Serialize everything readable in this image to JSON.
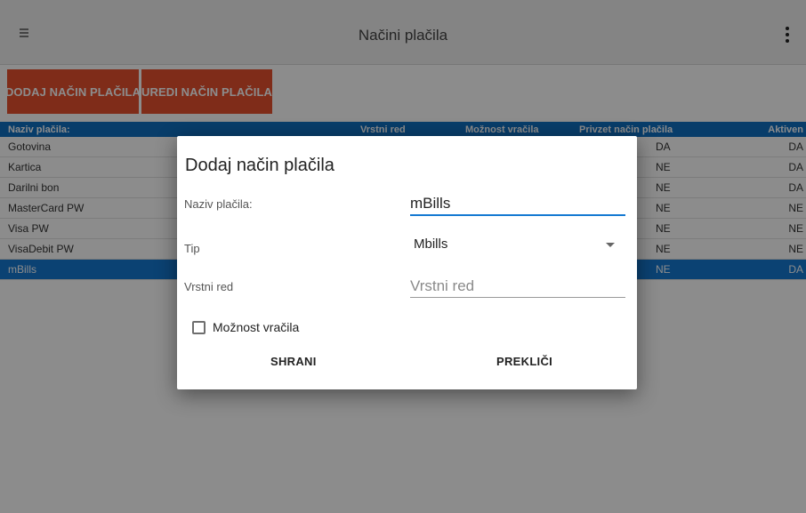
{
  "appbar": {
    "title": "Načini plačila",
    "menu_icon": "hamburger-icon",
    "overflow_icon": "more-vert-icon"
  },
  "actions": {
    "add": "DODAJ NAČIN PLAČILA",
    "edit": "UREDI NAČIN PLAČILA"
  },
  "colors": {
    "accent": "#e8512f",
    "header_blue": "#0f6fc2",
    "selected_row": "#1479d2"
  },
  "table": {
    "headers": {
      "name": "Naziv plačila:",
      "order": "Vrstni red",
      "refund": "Možnost vračila",
      "default": "Privzet način plačila",
      "active": "Aktiven"
    },
    "rows": [
      {
        "name": "Gotovina",
        "default": "DA",
        "active": "DA"
      },
      {
        "name": "Kartica",
        "default": "NE",
        "active": "DA"
      },
      {
        "name": "Darilni bon",
        "default": "NE",
        "active": "DA"
      },
      {
        "name": "MasterCard PW",
        "default": "NE",
        "active": "NE"
      },
      {
        "name": "Visa PW",
        "default": "NE",
        "active": "NE"
      },
      {
        "name": "VisaDebit PW",
        "default": "NE",
        "active": "NE"
      },
      {
        "name": "mBills",
        "default": "NE",
        "active": "DA",
        "selected": true
      }
    ]
  },
  "dialog": {
    "title": "Dodaj način plačila",
    "name_label": "Naziv plačila:",
    "name_value": "mBills",
    "type_label": "Tip",
    "type_value": "Mbills",
    "order_label": "Vrstni red",
    "order_placeholder": "Vrstni red",
    "refund_checkbox_label": "Možnost vračila",
    "refund_checked": false,
    "save": "SHRANI",
    "cancel": "PREKLIČI"
  }
}
